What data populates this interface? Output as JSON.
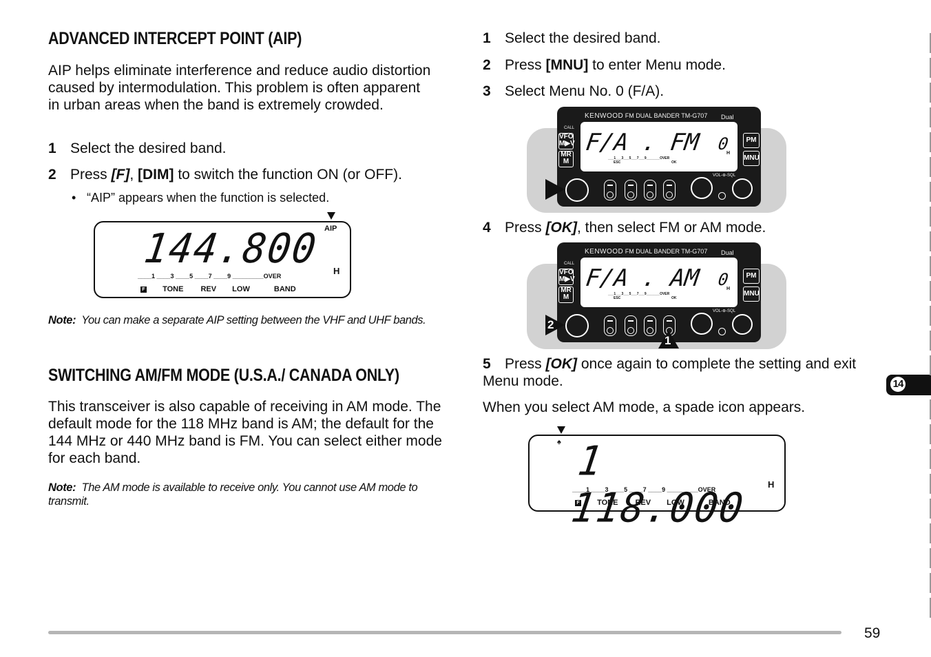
{
  "left": {
    "aip": {
      "title": "ADVANCED INTERCEPT POINT (AIP)",
      "intro": "AIP helps eliminate interference and reduce audio distortion caused by intermodulation.  This problem is often apparent in urban areas when the band is extremely crowded.",
      "steps": [
        {
          "num": "1",
          "text": "Select the desired band."
        },
        {
          "num": "2",
          "pre": "Press ",
          "key_f": "[F]",
          "sep": ", ",
          "key_dim": "[DIM]",
          "post": " to switch the function ON (or OFF)."
        }
      ],
      "bullet": "“AIP” appears when the function is selected.",
      "display": {
        "frequency": "144.800",
        "indicator": "AIP",
        "power": "H",
        "meter": "____1 ____3 ____5 ____7 ____9 _________OVER",
        "f_label": "F",
        "function_labels": [
          "TONE",
          "REV",
          "LOW",
          "BAND"
        ]
      },
      "note_label": "Note:",
      "note_text": "You can make a separate AIP setting between the VHF and UHF bands."
    },
    "amfm": {
      "title": "SWITCHING AM/FM MODE (U.S.A./ CANADA ONLY)",
      "intro": "This transceiver is also capable of receiving in AM mode. The default mode for the 118 MHz band is AM; the default for the 144 MHz or 440 MHz band is FM.  You can select either mode for each band.",
      "note_label": "Note:",
      "note_text": "The AM mode is available to receive only.  You cannot use AM mode to transmit."
    }
  },
  "right": {
    "steps": [
      {
        "num": "1",
        "text": "Select the desired band."
      },
      {
        "num": "2",
        "pre": "Press ",
        "key": "[MNU]",
        "post": " to enter Menu mode."
      },
      {
        "num": "3",
        "text": "Select Menu No. 0 (F/A)."
      },
      {
        "num": "4",
        "pre": "Press ",
        "key": "[OK]",
        "post": ", then select FM or AM mode."
      },
      {
        "num": "5",
        "pre": "Press ",
        "key": "[OK]",
        "post": " once again to complete the setting and exit Menu mode."
      }
    ],
    "radio1": {
      "brand": "KENWOOD",
      "model": "FM DUAL BANDER  TM-G707",
      "dual": "Dual",
      "screen_text": "F/A . FM",
      "menu_no": "0",
      "power": "H",
      "meter": "___1___3___5___7___9_______OVER",
      "esc": "ESC",
      "ok": "OK",
      "call": "CALL",
      "vfo": "VFO",
      "mv": "M▶V",
      "mr": "MR",
      "m": "M",
      "pm": "PM",
      "mnu": "MNU",
      "volsql": "VOL-⊕-SQL"
    },
    "radio2": {
      "brand": "KENWOOD",
      "model": "FM DUAL BANDER  TM-G707",
      "dual": "Dual",
      "screen_text": "F/A . AM",
      "menu_no": "0",
      "power": "H",
      "meter": "___1___3___5___7___9_______OVER",
      "esc": "ESC",
      "ok": "OK",
      "call": "CALL",
      "vfo": "VFO",
      "mv": "M▶V",
      "mr": "MR",
      "m": "M",
      "pm": "PM",
      "mnu": "MNU",
      "volsql": "VOL-⊕-SQL",
      "callout_1": "1",
      "callout_2": "2"
    },
    "am_sentence": "When you select AM mode, a spade icon appears.",
    "display": {
      "frequency": "1 118.000",
      "spade": "♠",
      "power": "H",
      "meter": "____1 ____3 ____5 ____7 ____9 _________OVER",
      "f_label": "F",
      "function_labels": [
        "TONE",
        "REV",
        "LOW",
        "BAND"
      ]
    }
  },
  "chapter_tab": "14",
  "page_number": "59"
}
